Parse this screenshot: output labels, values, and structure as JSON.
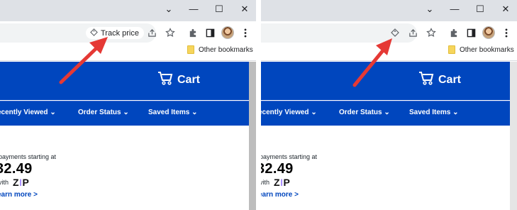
{
  "left_panel": {
    "track_price_label": "Track price",
    "bookmark_label": "Other bookmarks",
    "cart_label": "Cart",
    "nav": [
      "ecently Viewed",
      "Order Status",
      "Saved Items"
    ],
    "payments_text": "payments starting at",
    "price": "32.49",
    "with_text": "vith",
    "zip_logo": "ZIP",
    "learn_more": "earn more >"
  },
  "right_panel": {
    "bookmark_label": "Other bookmarks",
    "cart_label": "Cart",
    "nav": [
      "ecently Viewed",
      "Order Status",
      "Saved Items"
    ],
    "payments_text": "payments starting at",
    "price": "32.49",
    "with_text": "vith",
    "zip_logo": "ZIP",
    "learn_more": "earn more >"
  },
  "window_controls": {
    "minimize": "—",
    "maximize": "☐",
    "close": "✕",
    "dropdown": "⌄"
  },
  "colors": {
    "brand_blue": "#0046be",
    "annotation_red": "#e53935",
    "zip_purple": "#aa8fff"
  },
  "icons": [
    "track-price-icon",
    "share-icon",
    "star-icon",
    "extensions-icon",
    "side-panel-icon",
    "avatar",
    "menu-icon",
    "cart-icon"
  ]
}
